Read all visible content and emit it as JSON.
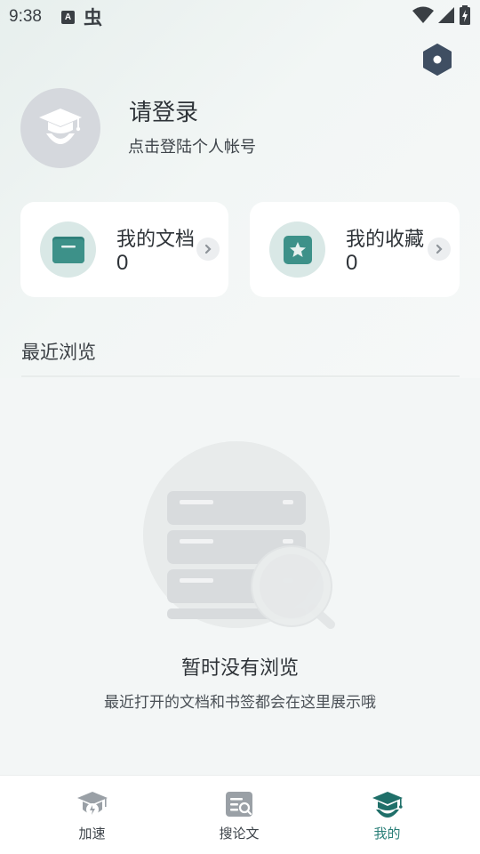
{
  "status_bar": {
    "time": "9:38",
    "a_badge": "A",
    "bug_glyph": "虫"
  },
  "header": {
    "settings_icon": "hexagon-settings-icon"
  },
  "profile": {
    "avatar_icon": "graduation-cap-user-icon",
    "title": "请登录",
    "subtitle": "点击登陆个人帐号"
  },
  "cards": [
    {
      "title": "我的文档",
      "count": "0",
      "icon": "folder-icon"
    },
    {
      "title": "我的收藏",
      "count": "0",
      "icon": "star-icon"
    }
  ],
  "recent": {
    "title": "最近浏览",
    "empty_title": "暂时没有浏览",
    "empty_subtitle": "最近打开的文档和书签都会在这里展示哦"
  },
  "nav": [
    {
      "label": "加速",
      "icon": "graduation-speed-icon",
      "active": false
    },
    {
      "label": "搜论文",
      "icon": "search-paper-icon",
      "active": false
    },
    {
      "label": "我的",
      "icon": "graduation-cap-user-icon",
      "active": true
    }
  ],
  "colors": {
    "accent": "#2a7f78",
    "icon_teal": "#3a8f88",
    "inactive": "#9aa0a6"
  }
}
